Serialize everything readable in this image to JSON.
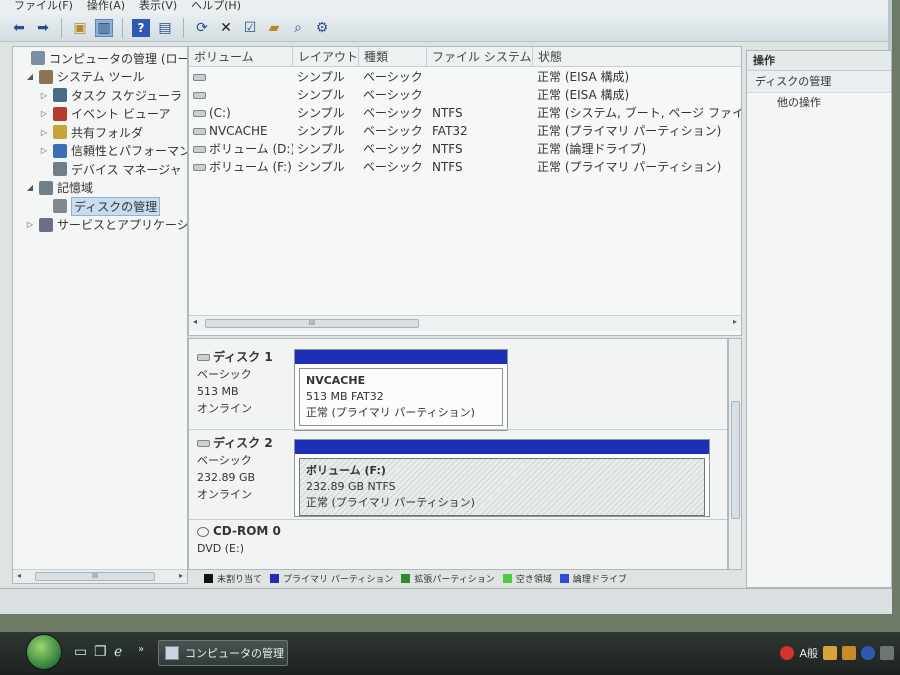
{
  "menu": [
    "ファイル(F)",
    "操作(A)",
    "表示(V)",
    "ヘルプ(H)"
  ],
  "toolbar": {
    "back_icon": "back-arrow-icon",
    "forward_icon": "forward-arrow-icon"
  },
  "tree": {
    "items": [
      {
        "label": "コンピュータの管理 (ローカル",
        "level": 0,
        "arrow": "",
        "icon": "computer-management-icon",
        "color": "#7a8fa3"
      },
      {
        "label": "システム ツール",
        "level": 1,
        "arrow": "◢",
        "icon": "system-tools-icon",
        "color": "#8a7654"
      },
      {
        "label": "タスク スケジューラ",
        "level": 2,
        "arrow": "▷",
        "icon": "task-scheduler-icon",
        "color": "#4a6a8a"
      },
      {
        "label": "イベント ビューア",
        "level": 2,
        "arrow": "▷",
        "icon": "event-viewer-icon",
        "color": "#b33c2c"
      },
      {
        "label": "共有フォルダ",
        "level": 2,
        "arrow": "▷",
        "icon": "shared-folder-icon",
        "color": "#c9a23a"
      },
      {
        "label": "信頼性とパフォーマンス",
        "level": 2,
        "arrow": "▷",
        "icon": "reliability-icon",
        "color": "#3b6fb3"
      },
      {
        "label": "デバイス マネージャ",
        "level": 2,
        "arrow": "",
        "icon": "device-manager-icon",
        "color": "#6f7f8a"
      },
      {
        "label": "記憶域",
        "level": 1,
        "arrow": "◢",
        "icon": "storage-icon",
        "color": "#6f7f8a"
      },
      {
        "label": "ディスクの管理",
        "level": 2,
        "arrow": "",
        "icon": "disk-management-icon",
        "color": "#7e8a90",
        "selected": true
      },
      {
        "label": "サービスとアプリケーショ",
        "level": 1,
        "arrow": "▷",
        "icon": "services-icon",
        "color": "#6b6f8a"
      }
    ],
    "scroll_glyph": "III"
  },
  "volumes": {
    "headers": [
      "ボリューム",
      "レイアウト",
      "種類",
      "ファイル システム",
      "状態"
    ],
    "rows": [
      {
        "name": "",
        "layout": "シンプル",
        "type": "ベーシック",
        "fs": "",
        "status": "正常 (EISA 構成)"
      },
      {
        "name": "",
        "layout": "シンプル",
        "type": "ベーシック",
        "fs": "",
        "status": "正常 (EISA 構成)"
      },
      {
        "name": "(C:)",
        "layout": "シンプル",
        "type": "ベーシック",
        "fs": "NTFS",
        "status": "正常 (システム, ブート, ページ ファイル"
      },
      {
        "name": "NVCACHE",
        "layout": "シンプル",
        "type": "ベーシック",
        "fs": "FAT32",
        "status": "正常 (プライマリ パーティション)"
      },
      {
        "name": "ボリューム (D:)",
        "layout": "シンプル",
        "type": "ベーシック",
        "fs": "NTFS",
        "status": "正常 (論理ドライブ)"
      },
      {
        "name": "ボリューム (F:)",
        "layout": "シンプル",
        "type": "ベーシック",
        "fs": "NTFS",
        "status": "正常 (プライマリ パーティション)"
      }
    ],
    "scroll_glyph": "III"
  },
  "disks": [
    {
      "name": "ディスク 1",
      "kind": "ベーシック",
      "size": "513 MB",
      "state": "オンライン",
      "partition": {
        "name": "NVCACHE",
        "detail": "513 MB FAT32",
        "status": "正常 (プライマリ パーティション)",
        "bar_color": "#1e2fb7"
      }
    },
    {
      "name": "ディスク 2",
      "kind": "ベーシック",
      "size": "232.89 GB",
      "state": "オンライン",
      "partition": {
        "name": "ボリューム (F:)",
        "detail": "232.89 GB NTFS",
        "status": "正常 (プライマリ パーティション)",
        "bar_color": "#1e2fb7"
      }
    },
    {
      "name": "CD-ROM 0",
      "kind": "DVD (E:)"
    }
  ],
  "legend": [
    {
      "label": "未割り当て",
      "color": "#111111"
    },
    {
      "label": "プライマリ パーティション",
      "color": "#1e2fb7"
    },
    {
      "label": "拡張パーティション",
      "color": "#2d8a2d"
    },
    {
      "label": "空き領域",
      "color": "#4ccc3c"
    },
    {
      "label": "論理ドライブ",
      "color": "#2f49d8"
    }
  ],
  "actions": {
    "header": "操作",
    "section": "ディスクの管理",
    "item": "他の操作"
  },
  "taskbar": {
    "task_label": "コンピュータの管理",
    "ime_label": "A般"
  }
}
